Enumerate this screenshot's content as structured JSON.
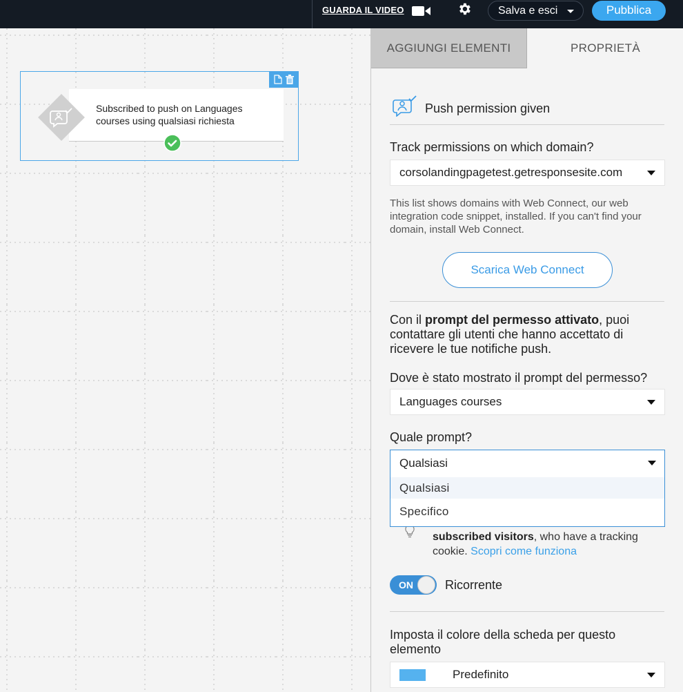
{
  "topbar": {
    "watch_video": "GUARDA IL VIDEO",
    "save_label": "Salva e esci",
    "publish_label": "Pubblica"
  },
  "canvas": {
    "node": {
      "text": "Subscribed to push on Languages courses using qualsiasi richiesta"
    }
  },
  "panel": {
    "tabs": {
      "add": "AGGIUNGI ELEMENTI",
      "props": "PROPRIETÀ"
    },
    "element_title": "Push permission given",
    "domain_label": "Track permissions on which domain?",
    "domain_value": "corsolandingpagetest.getresponsesite.com",
    "domain_help": "This list shows domains with Web Connect, our web integration code snippet, installed. If you can't find your domain, install Web Connect.",
    "download_button": "Scarica Web Connect",
    "para_prefix": "Con il ",
    "para_bold": "prompt del permesso attivato",
    "para_suffix": ", puoi contattare gli utenti che hanno accettato di ricevere le tue notifiche push.",
    "where_label": "Dove è stato mostrato il prompt del permesso?",
    "where_value": "Languages courses",
    "which_label": "Quale prompt?",
    "which_value": "Qualsiasi",
    "which_options": [
      "Qualsiasi",
      "Specifico"
    ],
    "note_bold": "subscribed visitors",
    "note_text": ", who have a tracking cookie. ",
    "note_link": "Scopri come funziona",
    "toggle_state": "ON",
    "toggle_label": "Ricorrente",
    "color_label": "Imposta il colore della scheda per questo elemento",
    "color_value": "Predefinito",
    "color_swatch": "#55b2ef"
  },
  "colors": {
    "accent": "#3ba7ef",
    "topbar": "#141b24",
    "success": "#4bbf5a"
  }
}
